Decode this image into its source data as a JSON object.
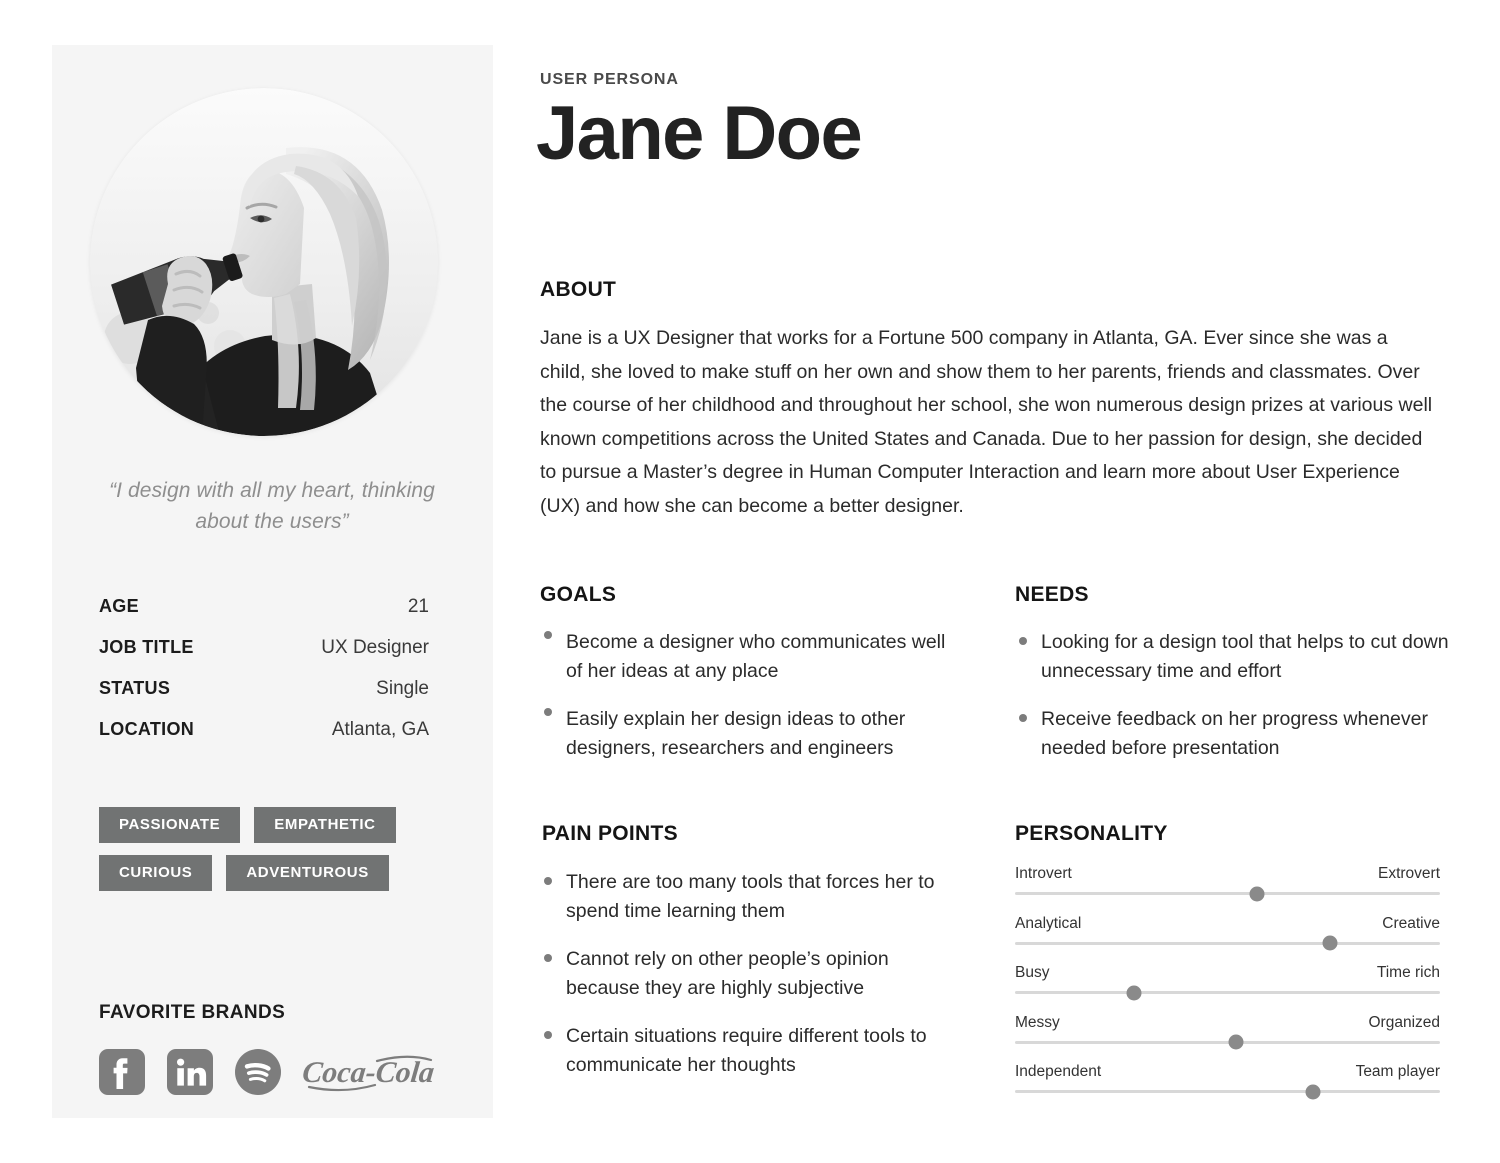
{
  "document": {
    "eyebrow": "USER PERSONA",
    "name": "Jane Doe"
  },
  "sidebar": {
    "avatar_alt": "portrait-photo-woman-drinking-from-bottle",
    "quote": "“I design with all my heart, thinking about the users”",
    "attributes": [
      {
        "label": "AGE",
        "value": "21"
      },
      {
        "label": "JOB TITLE",
        "value": "UX Designer"
      },
      {
        "label": "STATUS",
        "value": "Single"
      },
      {
        "label": "LOCATION",
        "value": "Atlanta, GA"
      }
    ],
    "tags": [
      "PASSIONATE",
      "EMPATHETIC",
      "CURIOUS",
      "ADVENTUROUS"
    ],
    "brands_heading": "FAVORITE BRANDS",
    "brands": [
      {
        "name": "facebook-logo",
        "label": "Facebook"
      },
      {
        "name": "linkedin-logo",
        "label": "LinkedIn"
      },
      {
        "name": "spotify-logo",
        "label": "Spotify"
      },
      {
        "name": "coca-cola-logo",
        "label": "Coca-Cola"
      }
    ]
  },
  "sections": {
    "about": {
      "heading": "ABOUT",
      "body": "Jane is a UX Designer that works for a Fortune 500 company in Atlanta, GA. Ever since she was a child, she loved to make stuff on her own and show them to her parents, friends and classmates. Over the course of her childhood and throughout her school, she won numerous design prizes at various well known competitions across the United States and Canada. Due to her passion for design, she decided to pursue a Master’s degree in Human Computer Interaction and learn more about User Experience (UX) and how she can become a better designer."
    },
    "goals": {
      "heading": "GOALS",
      "items": [
        "Become a designer who communicates well of her ideas at any place",
        "Easily explain her design ideas to other designers, researchers and engineers"
      ]
    },
    "needs": {
      "heading": "NEEDS",
      "items": [
        "Looking for a design tool that helps to cut down unnecessary time and effort",
        "Receive feedback on her progress whenever needed before presentation"
      ]
    },
    "pain_points": {
      "heading": "PAIN POINTS",
      "items": [
        "There are too many tools that forces her to spend time learning them",
        " Cannot rely on other people’s opinion because they are highly subjective",
        "Certain situations require different tools to communicate her thoughts"
      ]
    },
    "personality": {
      "heading": "PERSONALITY",
      "scales": [
        {
          "left": "Introvert",
          "right": "Extrovert",
          "value": 57
        },
        {
          "left": "Analytical",
          "right": "Creative",
          "value": 74
        },
        {
          "left": "Busy",
          "right": "Time rich",
          "value": 28
        },
        {
          "left": "Messy",
          "right": "Organized",
          "value": 52
        },
        {
          "left": "Independent",
          "right": "Team player",
          "value": 70
        }
      ]
    }
  },
  "colors": {
    "page_background": "#ffffff",
    "sidebar_background": "#f5f5f5",
    "tag_background": "#717373",
    "tag_text": "#ffffff",
    "heading_text": "#151515",
    "body_text": "#2b2b2b",
    "quote_text": "#8e8e8e",
    "bullet_dot": "#7c7c7c",
    "slider_track": "#d8d8d8",
    "slider_thumb": "#8a8a8a",
    "brand_logo": "#7d7d7d"
  }
}
